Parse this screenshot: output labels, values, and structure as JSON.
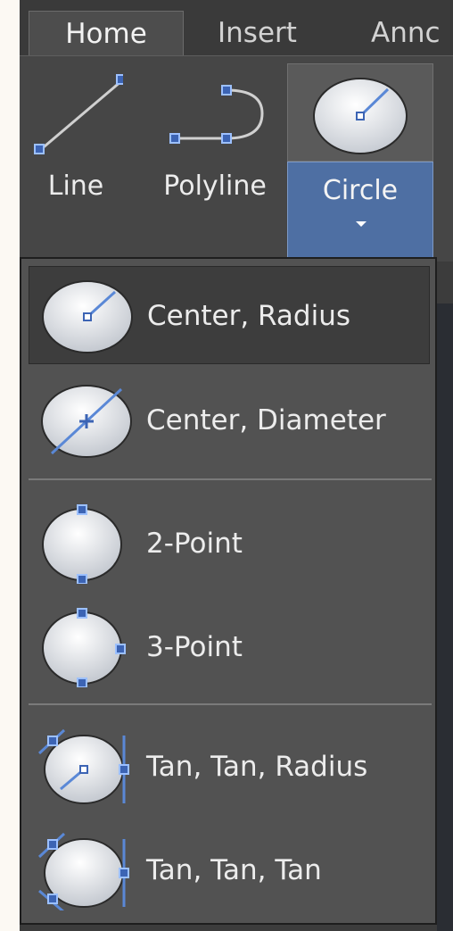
{
  "tabs": [
    {
      "label": "Home",
      "active": true
    },
    {
      "label": "Insert",
      "active": false
    },
    {
      "label": "Annc",
      "active": false
    }
  ],
  "ribbon": {
    "line_label": "Line",
    "polyline_label": "Polyline",
    "circle_label": "Circle"
  },
  "dropdown": {
    "items": [
      {
        "label": "Center, Radius",
        "icon": "circle-center-radius-icon",
        "highlighted": true
      },
      {
        "label": "Center, Diameter",
        "icon": "circle-center-diameter-icon"
      },
      {
        "label": "2-Point",
        "icon": "circle-2-point-icon"
      },
      {
        "label": "3-Point",
        "icon": "circle-3-point-icon"
      },
      {
        "label": "Tan, Tan, Radius",
        "icon": "circle-tan-tan-radius-icon"
      },
      {
        "label": "Tan, Tan, Tan",
        "icon": "circle-tan-tan-tan-icon"
      }
    ]
  },
  "colors": {
    "ribbon_bg": "#464646",
    "menu_bg": "#525252",
    "highlight_bg": "#3d3d3d",
    "accent_blue": "#4e6fa3",
    "icon_line": "#6a93d6",
    "text": "#ececec"
  }
}
